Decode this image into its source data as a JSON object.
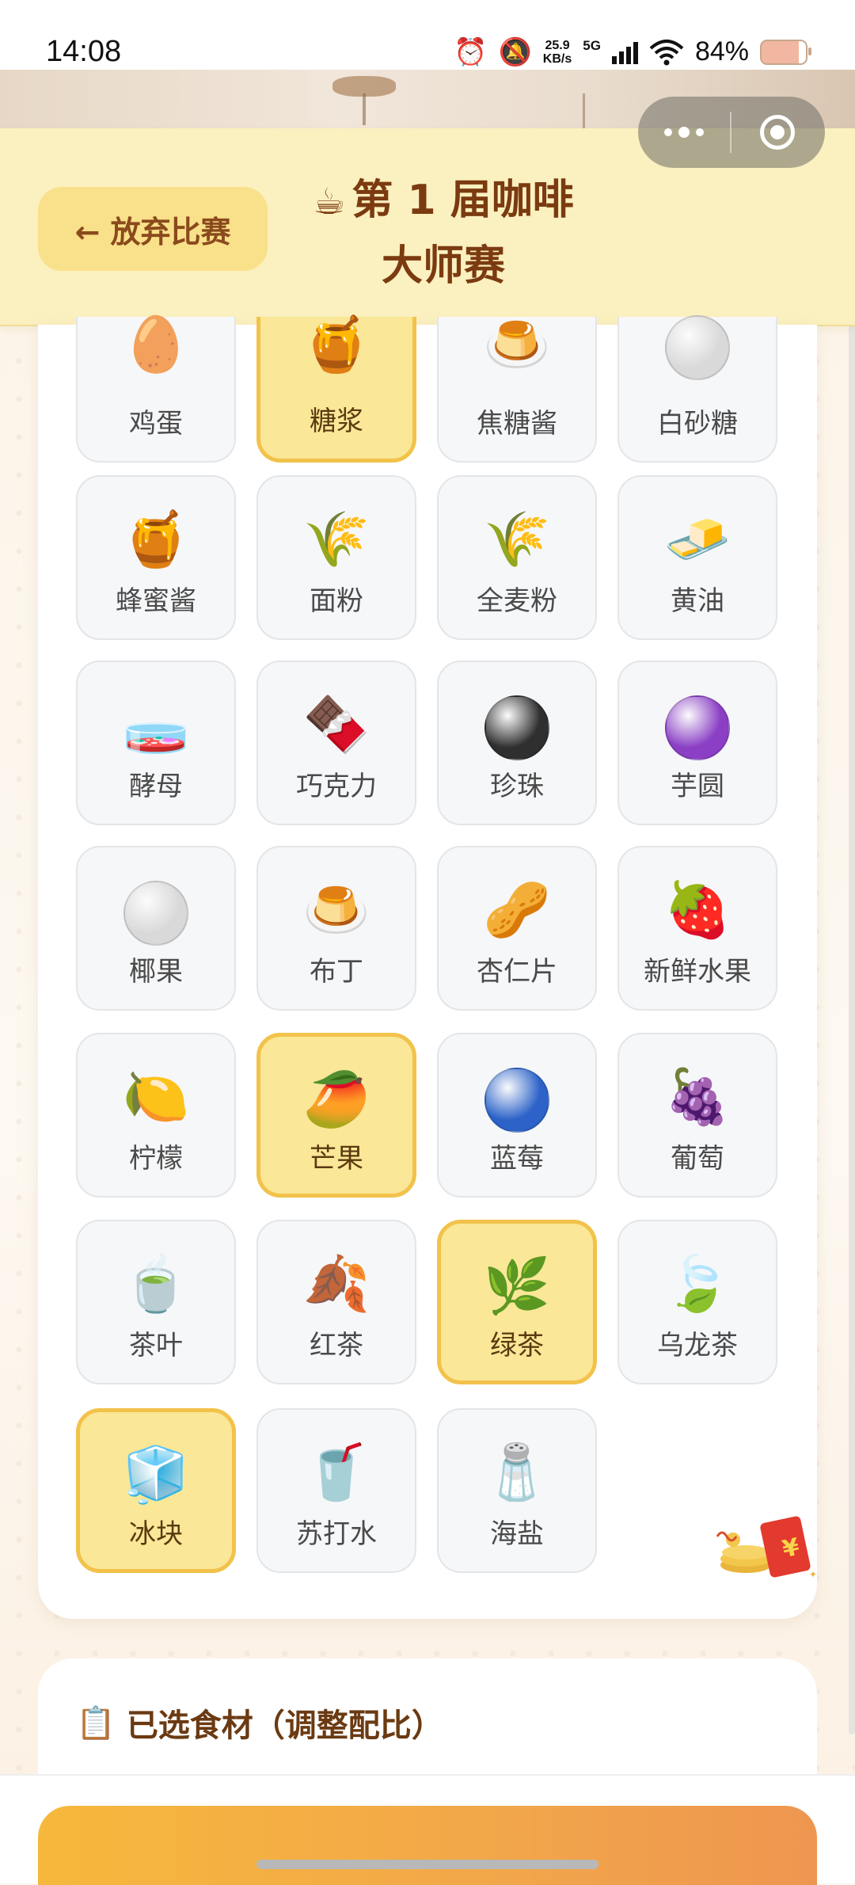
{
  "status_bar": {
    "time": "14:08",
    "net_speed_value": "25.9",
    "net_speed_unit": "KB/s",
    "network": "5G",
    "battery_percent": "84%"
  },
  "header": {
    "back_label": "← 放弃比赛",
    "title_icon": "☕",
    "title_line1": "第 1 届咖啡",
    "title_line2": "大师赛"
  },
  "ingredients": [
    {
      "label": "鸡蛋",
      "icon": "🥚",
      "selected": false
    },
    {
      "label": "糖浆",
      "icon": "🍯",
      "selected": true
    },
    {
      "label": "焦糖酱",
      "icon": "🍮",
      "selected": false
    },
    {
      "label": "白砂糖",
      "icon": "white-ball",
      "selected": false
    },
    {
      "label": "蜂蜜酱",
      "icon": "🍯",
      "selected": false
    },
    {
      "label": "面粉",
      "icon": "🌾",
      "selected": false
    },
    {
      "label": "全麦粉",
      "icon": "🌾",
      "selected": false
    },
    {
      "label": "黄油",
      "icon": "🧈",
      "selected": false
    },
    {
      "label": "酵母",
      "icon": "🧫",
      "selected": false
    },
    {
      "label": "巧克力",
      "icon": "🍫",
      "selected": false
    },
    {
      "label": "珍珠",
      "icon": "black-ball",
      "selected": false
    },
    {
      "label": "芋圆",
      "icon": "purple-ball",
      "selected": false
    },
    {
      "label": "椰果",
      "icon": "white-ball",
      "selected": false
    },
    {
      "label": "布丁",
      "icon": "🍮",
      "selected": false
    },
    {
      "label": "杏仁片",
      "icon": "🥜",
      "selected": false
    },
    {
      "label": "新鲜水果",
      "icon": "🍓",
      "selected": false
    },
    {
      "label": "柠檬",
      "icon": "🍋",
      "selected": false
    },
    {
      "label": "芒果",
      "icon": "🥭",
      "selected": true
    },
    {
      "label": "蓝莓",
      "icon": "blue-ball",
      "selected": false
    },
    {
      "label": "葡萄",
      "icon": "🍇",
      "selected": false
    },
    {
      "label": "茶叶",
      "icon": "🍵",
      "selected": false
    },
    {
      "label": "红茶",
      "icon": "🍂",
      "selected": false
    },
    {
      "label": "绿茶",
      "icon": "🌿",
      "selected": true
    },
    {
      "label": "乌龙茶",
      "icon": "🍃",
      "selected": false
    },
    {
      "label": "冰块",
      "icon": "🧊",
      "selected": true
    },
    {
      "label": "苏打水",
      "icon": "🥤",
      "selected": false
    },
    {
      "label": "海盐",
      "icon": "🧂",
      "selected": false
    }
  ],
  "ball_colors": {
    "white-ball": "#d9d9d9",
    "black-ball": "#2f2f2f",
    "purple-ball": "#8a3fc4",
    "blue-ball": "#2d63c8"
  },
  "red_packet_symbol": "¥",
  "selected_section": {
    "icon": "📋",
    "heading": "已选食材（调整配比）"
  }
}
